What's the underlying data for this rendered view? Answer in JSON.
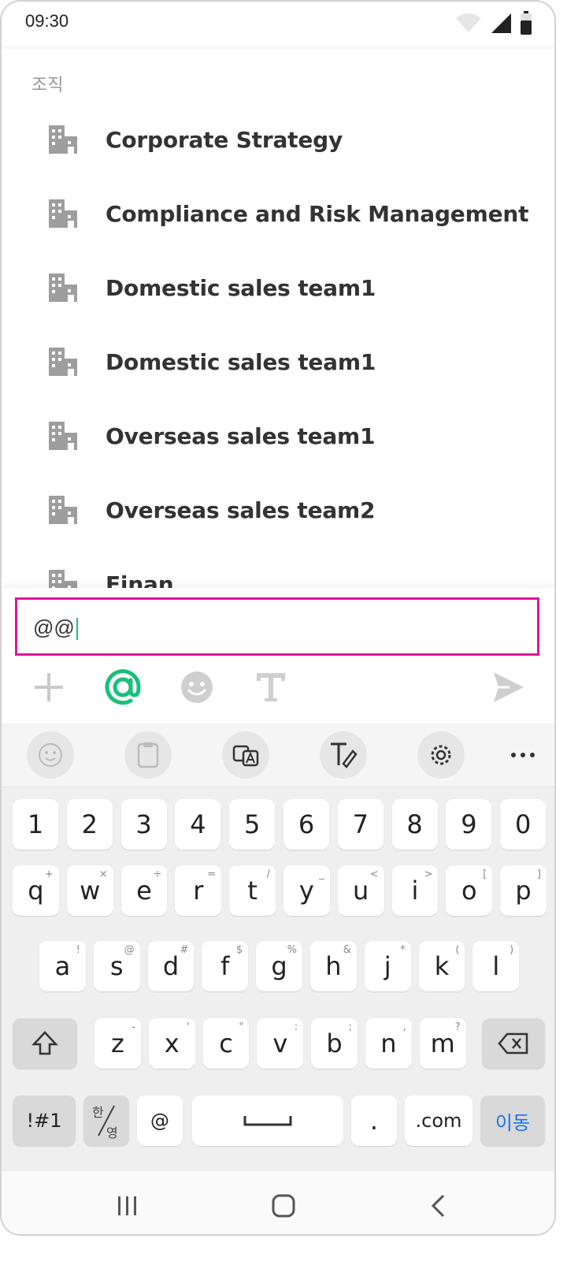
{
  "status": {
    "time": "09:30"
  },
  "section_label": "조직",
  "organizations": [
    "Corporate Strategy",
    "Compliance and Risk Management",
    "Domestic sales team1",
    "Domestic sales team1",
    "Overseas sales team1",
    "Overseas sales team2",
    "Finan"
  ],
  "composer": {
    "input_value": "@@",
    "toolbar": [
      "plus-icon",
      "mention-icon",
      "emoji-icon",
      "text-format-icon",
      "send-icon"
    ],
    "accent": "#18c07a",
    "focus_border": "#e0169a"
  },
  "keyboard": {
    "numbers": [
      "1",
      "2",
      "3",
      "4",
      "5",
      "6",
      "7",
      "8",
      "9",
      "0"
    ],
    "row1": [
      [
        "q",
        "+"
      ],
      [
        "w",
        "×"
      ],
      [
        "e",
        "÷"
      ],
      [
        "r",
        "="
      ],
      [
        "t",
        "/"
      ],
      [
        "y",
        "_"
      ],
      [
        "u",
        "<"
      ],
      [
        "i",
        ">"
      ],
      [
        "o",
        "["
      ],
      [
        "p",
        "]"
      ]
    ],
    "row2": [
      [
        "a",
        "!"
      ],
      [
        "s",
        "@"
      ],
      [
        "d",
        "#"
      ],
      [
        "f",
        "$"
      ],
      [
        "g",
        "%"
      ],
      [
        "h",
        "&"
      ],
      [
        "j",
        "*"
      ],
      [
        "k",
        "("
      ],
      [
        "l",
        ")"
      ]
    ],
    "row3": [
      [
        "z",
        "-"
      ],
      [
        "x",
        "'"
      ],
      [
        "c",
        "\""
      ],
      [
        "v",
        ":"
      ],
      [
        "b",
        ";"
      ],
      [
        "n",
        ","
      ],
      [
        "m",
        "?"
      ]
    ],
    "symbols_label": "!#1",
    "lang_top": "한",
    "lang_bottom": "영",
    "at_label": "@",
    "period_label": ".",
    "dotcom_label": ".com",
    "enter_label": "이동"
  }
}
